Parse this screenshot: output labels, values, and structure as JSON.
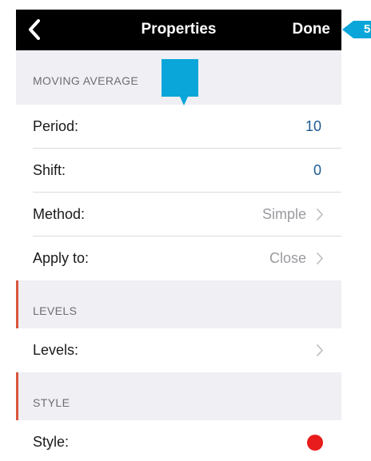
{
  "navbar": {
    "title": "Properties",
    "done_label": "Done"
  },
  "sections": {
    "moving_average": "MOVING AVERAGE",
    "levels": "LEVELS",
    "style": "STYLE"
  },
  "rows": {
    "period": {
      "label": "Period:",
      "value": "10"
    },
    "shift": {
      "label": "Shift:",
      "value": "0"
    },
    "method": {
      "label": "Method:",
      "value": "Simple"
    },
    "apply_to": {
      "label": "Apply to:",
      "value": "Close"
    },
    "levels": {
      "label": "Levels:"
    },
    "style": {
      "label": "Style:",
      "color": "#e81c1c"
    }
  },
  "callouts": {
    "top_number": "5",
    "color": "#0aa6d9"
  },
  "colors": {
    "accent_line": "#d9553e",
    "value_blue": "#1e5a91"
  }
}
